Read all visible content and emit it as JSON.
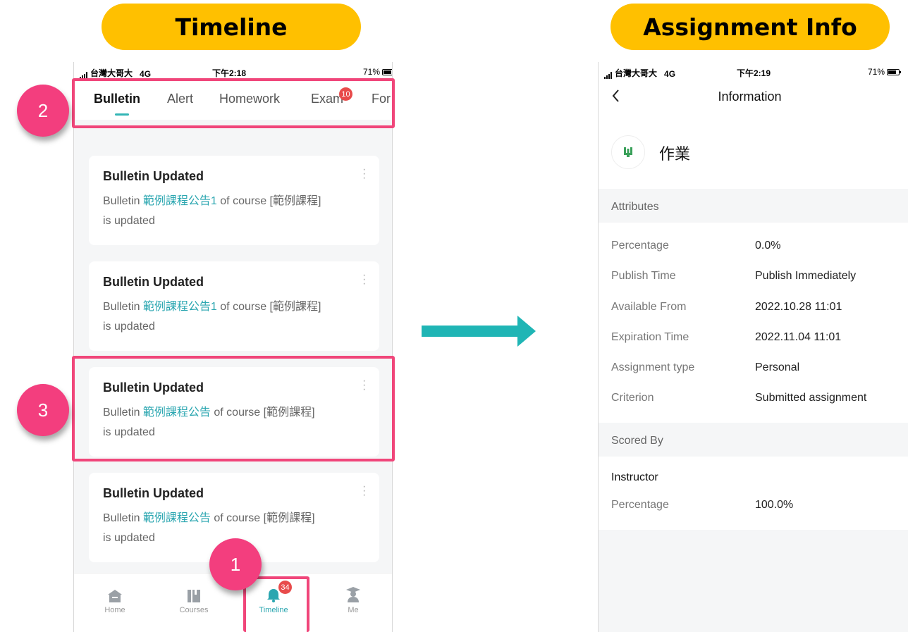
{
  "labels": {
    "left_title": "Timeline",
    "right_title": "Assignment Info"
  },
  "status_left": {
    "carrier": "台灣大哥大",
    "network": "4G",
    "time": "下午2:18",
    "battery": "71%"
  },
  "status_right": {
    "carrier": "台灣大哥大",
    "network": "4G",
    "time": "下午2:19",
    "battery": "71%"
  },
  "tabs": [
    "Bulletin",
    "Alert",
    "Homework",
    "Exam",
    "For"
  ],
  "active_tab": "Bulletin",
  "badges": {
    "exam": "10",
    "timeline": "34"
  },
  "cards": [
    {
      "title": "Bulletin Updated",
      "prefix": "Bulletin ",
      "link": "範例課程公告1",
      "suffix": " of course [範例課程]",
      "line2": "is updated"
    },
    {
      "title": "Bulletin Updated",
      "prefix": "Bulletin ",
      "link": "範例課程公告1",
      "suffix": " of course [範例課程]",
      "line2": "is updated"
    },
    {
      "title": "Bulletin Updated",
      "prefix": "Bulletin ",
      "link": "範例課程公告",
      "suffix": " of course [範例課程]",
      "line2": "is updated"
    },
    {
      "title": "Bulletin Updated",
      "prefix": "Bulletin ",
      "link": "範例課程公告",
      "suffix": " of course [範例課程]",
      "line2": "is updated"
    }
  ],
  "bottom_nav": [
    "Home",
    "Courses",
    "Timeline",
    "Me"
  ],
  "annotations": [
    "1",
    "2",
    "3"
  ],
  "info": {
    "back_icon": "chevron-left-icon",
    "title": "Information",
    "name": "作業",
    "attributes_label": "Attributes",
    "rows": [
      {
        "key": "Percentage",
        "value": "0.0%"
      },
      {
        "key": "Publish Time",
        "value": "Publish Immediately"
      },
      {
        "key": "Available From",
        "value": "2022.10.28 11:01"
      },
      {
        "key": "Expiration Time",
        "value": "2022.11.04 11:01"
      },
      {
        "key": "Assignment type",
        "value": "Personal"
      },
      {
        "key": "Criterion",
        "value": "Submitted assignment"
      }
    ],
    "scored_by_label": "Scored By",
    "scorer": "Instructor",
    "scorer_key": "Percentage",
    "scorer_value": "100.0%"
  },
  "colors": {
    "pill": "#ffc000",
    "highlight": "#f0467a",
    "annotation": "#f33e7e",
    "accent": "#2aa6b0",
    "arrow": "#1fb5b5",
    "badge": "#e84b4b"
  }
}
